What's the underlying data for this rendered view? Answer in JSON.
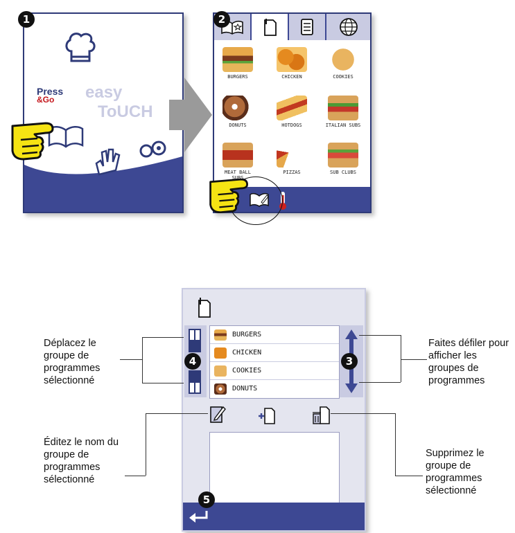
{
  "badges": {
    "one": "1",
    "two": "2",
    "three": "3",
    "four": "4",
    "five": "5"
  },
  "screen1": {
    "logo_press": "Press",
    "logo_go": "&Go",
    "logo_easy": "easy",
    "logo_touch": "ToUCH",
    "icons": [
      "chef-hat-icon",
      "book-icon",
      "hand-icon",
      "gears-icon"
    ]
  },
  "screen2": {
    "tabs": [
      "book-star-icon",
      "clipboard-icon",
      "list-icon",
      "globe-icon"
    ],
    "foods": [
      "BURGERS",
      "CHICKEN",
      "COOKIES",
      "DONUTS",
      "HOTDOGS",
      "ITALIAN SUBS",
      "MEAT BALL SUBS",
      "PIZZAS",
      "SUB CLUBS"
    ],
    "bottom_icons": [
      "book-edit-icon",
      "thermometer-icon"
    ]
  },
  "screen3": {
    "groups": [
      "BURGERS",
      "CHICKEN",
      "COOKIES",
      "DONUTS"
    ],
    "action_icons": [
      "edit-icon",
      "add-icon",
      "delete-icon"
    ],
    "back_icon": "return-arrow-icon"
  },
  "callouts": {
    "move": "Déplacez le groupe de programmes sélectionné",
    "scroll": "Faites défiler pour afficher les groupes de programmes",
    "edit": "Éditez le nom du groupe de programmes sélectionné",
    "delete": "Supprimez le groupe de programmes sélectionné"
  },
  "colors": {
    "accent": "#3d4893",
    "tab_bg": "#c9cbe2",
    "hand": "#f5e313"
  }
}
